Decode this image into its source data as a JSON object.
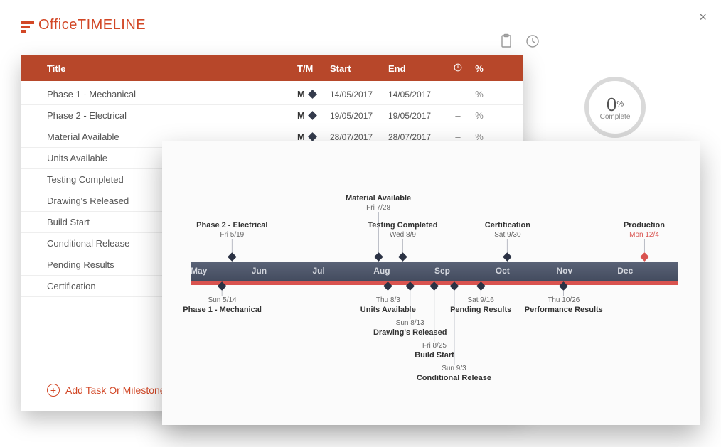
{
  "brand": {
    "name1": "Office",
    "name2": "TIMELINE"
  },
  "table": {
    "headers": {
      "title": "Title",
      "tm": "T/M",
      "start": "Start",
      "end": "End",
      "pctSymbol": "%"
    },
    "rows": [
      {
        "title": "Phase 1 - Mechanical",
        "tm": "M",
        "start": "14/05/2017",
        "end": "14/05/2017",
        "history": "–",
        "pct": "%"
      },
      {
        "title": "Phase 2 - Electrical",
        "tm": "M",
        "start": "19/05/2017",
        "end": "19/05/2017",
        "history": "–",
        "pct": "%"
      },
      {
        "title": "Material Available",
        "tm": "M",
        "start": "28/07/2017",
        "end": "28/07/2017",
        "history": "–",
        "pct": "%"
      },
      {
        "title": "Units Available",
        "tm": "",
        "start": "",
        "end": "",
        "history": "",
        "pct": ""
      },
      {
        "title": "Testing Completed",
        "tm": "",
        "start": "",
        "end": "",
        "history": "",
        "pct": ""
      },
      {
        "title": "Drawing's Released",
        "tm": "",
        "start": "",
        "end": "",
        "history": "",
        "pct": ""
      },
      {
        "title": "Build Start",
        "tm": "",
        "start": "",
        "end": "",
        "history": "",
        "pct": ""
      },
      {
        "title": "Conditional Release",
        "tm": "",
        "start": "",
        "end": "",
        "history": "",
        "pct": ""
      },
      {
        "title": "Pending Results",
        "tm": "",
        "start": "",
        "end": "",
        "history": "",
        "pct": ""
      },
      {
        "title": "Certification",
        "tm": "",
        "start": "",
        "end": "",
        "history": "",
        "pct": ""
      }
    ]
  },
  "addLabel": "Add Task Or Milestone",
  "progress": {
    "value": "0",
    "unit": "%",
    "label": "Complete"
  },
  "timeline": {
    "months": [
      "May",
      "Jun",
      "Jul",
      "Aug",
      "Sep",
      "Oct",
      "Nov",
      "Dec"
    ],
    "top": [
      {
        "name": "Phase 2 - Electrical",
        "date": "Fri 5/19",
        "pos": 8.5,
        "stem": 18
      },
      {
        "name": "Material Available",
        "date": "Fri 7/28",
        "pos": 38.5,
        "stem": 56
      },
      {
        "name": "Testing Completed",
        "date": "Wed 8/9",
        "pos": 43.5,
        "stem": 18
      },
      {
        "name": "Certification",
        "date": "Sat 9/30",
        "pos": 65,
        "stem": 18
      },
      {
        "name": "Production",
        "date": "Mon 12/4",
        "pos": 93,
        "stem": 18,
        "red": true
      }
    ],
    "bottom": [
      {
        "name": "Phase 1 - Mechanical",
        "date": "Sun 5/14",
        "pos": 6.5,
        "stem": 8
      },
      {
        "name": "Units Available",
        "date": "Thu 8/3",
        "pos": 40.5,
        "stem": 8
      },
      {
        "name": "Drawing's Released",
        "date": "Sun 8/13",
        "pos": 45,
        "stem": 40
      },
      {
        "name": "Build Start",
        "date": "Fri 8/25",
        "pos": 50,
        "stem": 72
      },
      {
        "name": "Conditional Release",
        "date": "Sun 9/3",
        "pos": 54,
        "stem": 104
      },
      {
        "name": "Pending Results",
        "date": "Sat 9/16",
        "pos": 59.5,
        "stem": 8
      },
      {
        "name": "Performance Results",
        "date": "Thu 10/26",
        "pos": 76.5,
        "stem": 8
      }
    ]
  }
}
